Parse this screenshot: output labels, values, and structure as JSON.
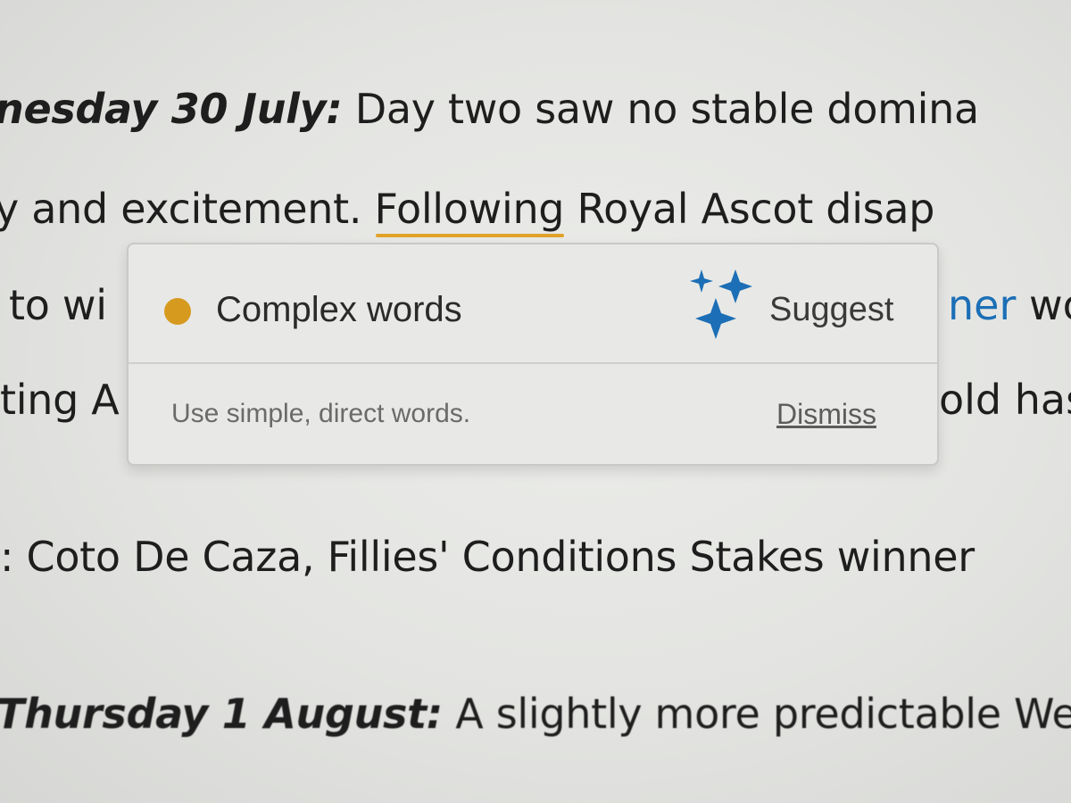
{
  "document": {
    "line1": {
      "date_label": "nesday 30 July:",
      "text": " Day two saw no stable domina"
    },
    "line2": {
      "before": "y and excitement. ",
      "flagged_word": "Following",
      "after": " Royal Ascot disap"
    },
    "line3": {
      "left": "to wi",
      "right_link": "ner",
      "right_rest": " wo"
    },
    "line4": {
      "left": "ting A",
      "right": "old has"
    },
    "line5": {
      "text": ": Coto De Caza, Fillies' Conditions Stakes winner"
    },
    "line6": {
      "date_label": "Thursday 1 August:",
      "text": " A slightly more predictable Wed"
    }
  },
  "popup": {
    "issue_title": "Complex words",
    "issue_color": "#d69a1f",
    "suggest_icon": "sparkle-icon",
    "suggest_label": "Suggest",
    "accent_color": "#1c6fb6",
    "description": "Use simple, direct words.",
    "dismiss_label": "Dismiss"
  }
}
